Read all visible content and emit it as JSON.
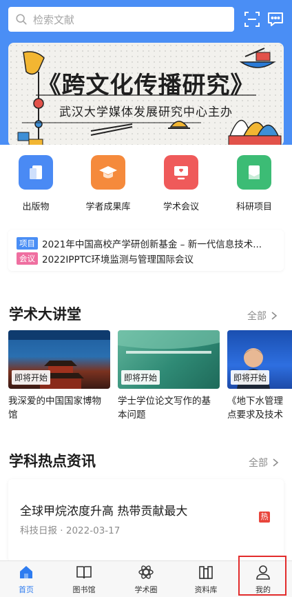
{
  "search": {
    "placeholder": "检索文献"
  },
  "header": {
    "scan_icon": "scan-icon",
    "message_icon": "message-icon"
  },
  "banner": {
    "title": "《跨文化传播研究》",
    "subtitle": "武汉大学媒体发展研究中心主办"
  },
  "categories": [
    {
      "label": "出版物",
      "icon": "publication-icon",
      "color": "#4a8af4"
    },
    {
      "label": "学者成果库",
      "icon": "graduation-cap-icon",
      "color": "#f58a3c"
    },
    {
      "label": "学术会议",
      "icon": "meeting-screen-icon",
      "color": "#ef5a5a"
    },
    {
      "label": "科研项目",
      "icon": "project-icon",
      "color": "#3cbc75"
    }
  ],
  "notices": [
    {
      "tag": "项目",
      "tag_color": "#4a8ef5",
      "text": "2021年中国高校产学研创新基金 – 新一代信息技术..."
    },
    {
      "tag": "会议",
      "tag_color": "#ef6fa0",
      "text": "2022IPPTC环境监测与管理国际会议"
    }
  ],
  "lectures_section": {
    "title": "学术大讲堂",
    "all_label": "全部",
    "items": [
      {
        "badge": "即将开始",
        "title": "我深爱的中国国家博物馆"
      },
      {
        "badge": "即将开始",
        "title": "学士学位论文写作的基本问题"
      },
      {
        "badge": "即将开始",
        "title": "《地下水管理点要求及技术"
      }
    ]
  },
  "news_section": {
    "title": "学科热点资讯",
    "all_label": "全部",
    "items": [
      {
        "title": "全球甲烷浓度升高  热带贡献最大",
        "meta": "科技日报 · 2022-03-17",
        "hot": "热"
      }
    ]
  },
  "tabbar": [
    {
      "label": "首页",
      "icon": "home-icon",
      "active": true
    },
    {
      "label": "图书馆",
      "icon": "book-icon",
      "active": false
    },
    {
      "label": "学术圈",
      "icon": "atom-icon",
      "active": false
    },
    {
      "label": "资料库",
      "icon": "archive-icon",
      "active": false
    },
    {
      "label": "我的",
      "icon": "user-icon",
      "active": false
    }
  ],
  "colors": {
    "accent": "#2e7cf0",
    "header": "#4a8ef5",
    "hot": "#e8453c",
    "highlight": "#e22b2b"
  }
}
